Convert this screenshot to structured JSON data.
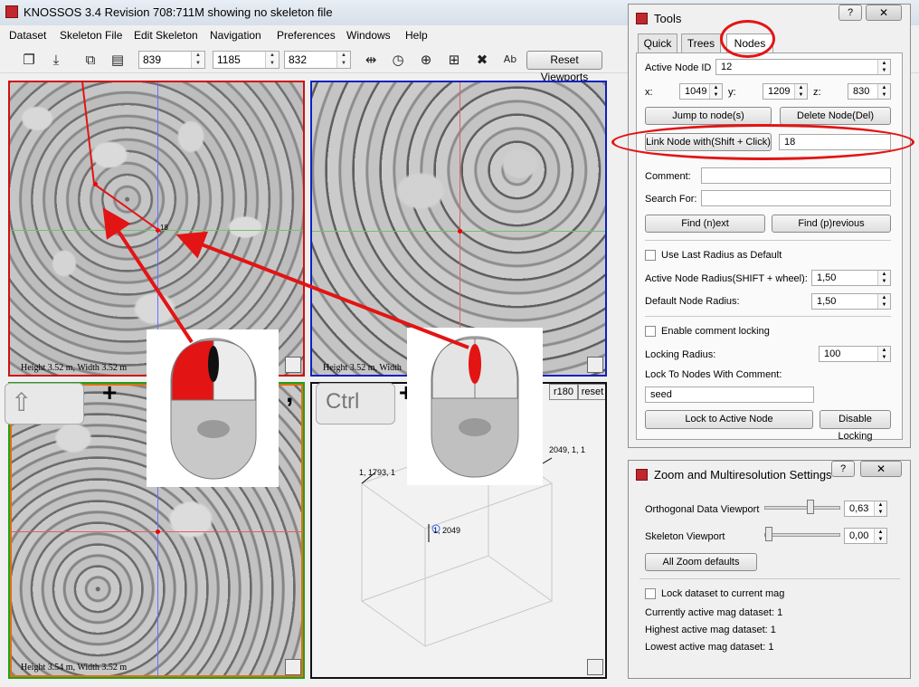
{
  "window": {
    "title": "KNOSSOS 3.4 Revision 708:711M showing no skeleton file"
  },
  "menu": [
    "Dataset",
    "Skeleton File",
    "Edit Skeleton",
    "Navigation",
    "Preferences",
    "Windows",
    "Help"
  ],
  "toolbar": {
    "coord_x": "839",
    "coord_y": "1185",
    "coord_z": "832",
    "reset_label": "Reset Viewports"
  },
  "viewports": {
    "xy_label": "Height 3.52 m, Width 3.52 m",
    "xz_label": "Height 3.52 m, Width",
    "yz_label": "Height 3.54 m, Width 3.52 m",
    "node_label": "18",
    "skel": {
      "r180": "r180",
      "reset": "reset",
      "corner_a": "1, 1793, 1",
      "corner_b": "2049, 1, 1",
      "corner_c": "1, 2049"
    }
  },
  "annotations": {
    "shift_key": "⇧",
    "ctrl_key": "Ctrl",
    "plus": "+",
    "comma": ","
  },
  "tools": {
    "title": "Tools",
    "tabs": [
      "Quick",
      "Trees",
      "Nodes"
    ],
    "active_node_label": "Active Node ID",
    "active_node_id": "12",
    "x_label": "x:",
    "x": "1049",
    "y_label": "y:",
    "y": "1209",
    "z_label": "z:",
    "z": "830",
    "jump_btn": "Jump to node(s)",
    "delete_btn": "Delete Node(Del)",
    "link_btn": "Link Node with(Shift + Click)",
    "link_value": "18",
    "comment_label": "Comment:",
    "search_label": "Search For:",
    "find_next": "Find (n)ext",
    "find_prev": "Find (p)revious",
    "use_last_radius": "Use Last Radius as Default",
    "active_radius_label": "Active Node Radius(SHIFT + wheel):",
    "active_radius": "1,50",
    "default_radius_label": "Default Node Radius:",
    "default_radius": "1,50",
    "enable_locking": "Enable comment locking",
    "locking_radius_label": "Locking Radius:",
    "locking_radius": "100",
    "lock_comment_label": "Lock To Nodes With Comment:",
    "lock_comment": "seed",
    "lock_active_btn": "Lock to Active Node",
    "disable_lock_btn": "Disable Locking"
  },
  "zoom": {
    "title": "Zoom and Multiresolution Settings",
    "ortho_label": "Orthogonal Data Viewport",
    "ortho_value": "0,63",
    "ortho_level": 0.6,
    "skel_label": "Skeleton Viewport",
    "skel_value": "0,00",
    "skel_level": 0.0,
    "defaults_btn": "All Zoom defaults",
    "lock_mag": "Lock dataset to current mag",
    "current_mag": "Currently active mag dataset: 1",
    "highest_mag": "Highest active mag dataset: 1",
    "lowest_mag": "Lowest active mag dataset: 1"
  },
  "colors": {
    "accent_red": "#e31414",
    "xy_border": "#d01010",
    "xz_border": "#1020c0",
    "yz_border": "#20a020"
  }
}
